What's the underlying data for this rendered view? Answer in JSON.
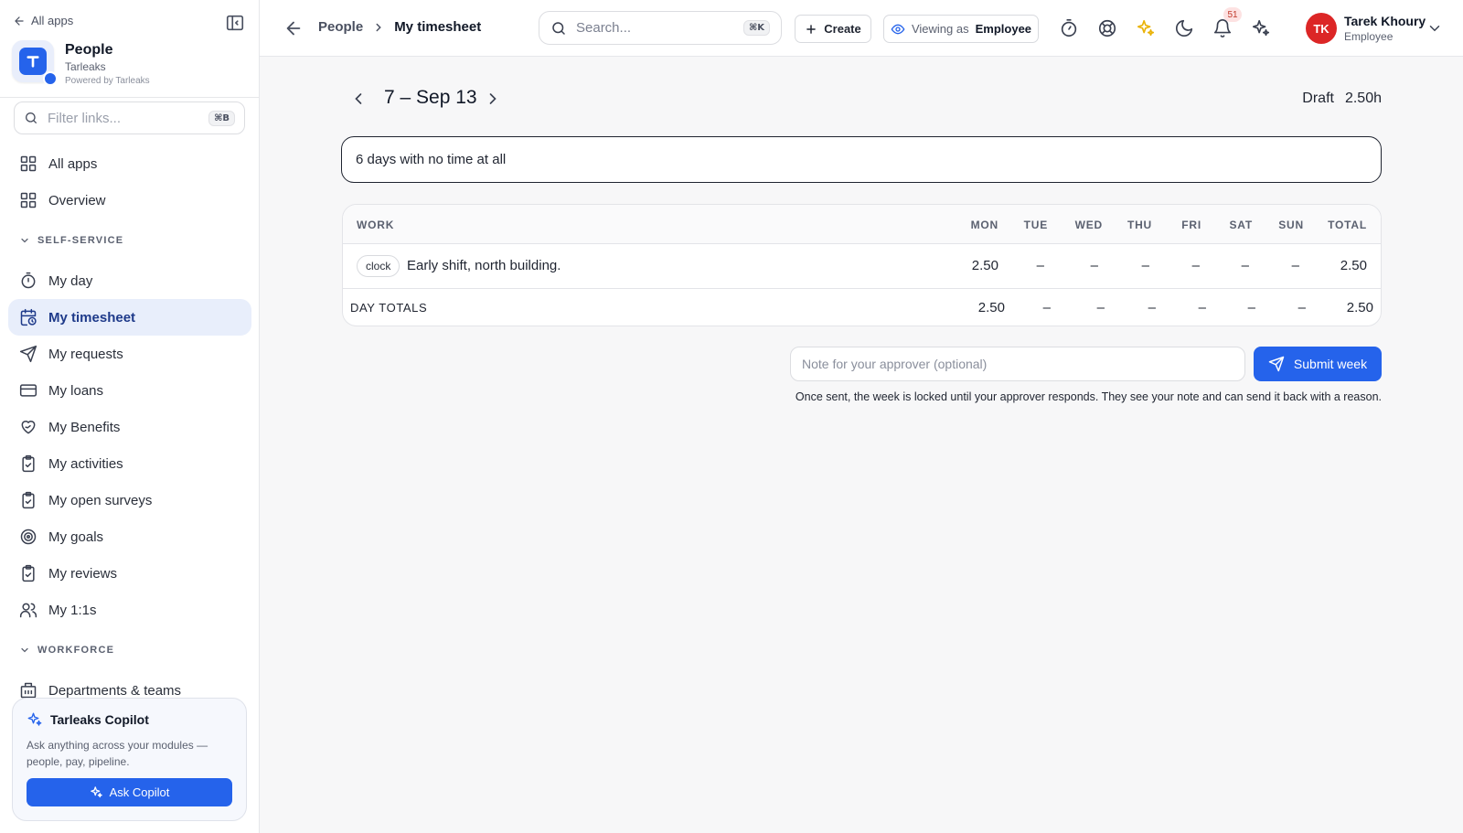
{
  "sidebar": {
    "back_label": "All apps",
    "app": {
      "name": "People",
      "org": "Tarleaks",
      "powered_by": "Powered by Tarleaks"
    },
    "filter": {
      "placeholder": "Filter links...",
      "shortcut": "⌘B"
    },
    "top_items": [
      {
        "label": "All apps",
        "icon": "grid-icon"
      },
      {
        "label": "Overview",
        "icon": "grid-icon"
      }
    ],
    "section_self_service": "SELF-SERVICE",
    "self_service_items": [
      {
        "label": "My day",
        "icon": "timer-icon"
      },
      {
        "label": "My timesheet",
        "icon": "calendar-clock-icon",
        "active": true
      },
      {
        "label": "My requests",
        "icon": "send-icon"
      },
      {
        "label": "My loans",
        "icon": "credit-card-icon"
      },
      {
        "label": "My Benefits",
        "icon": "heart-hand-icon"
      },
      {
        "label": "My activities",
        "icon": "clipboard-check-icon"
      },
      {
        "label": "My open surveys",
        "icon": "clipboard-check-icon"
      },
      {
        "label": "My goals",
        "icon": "target-icon"
      },
      {
        "label": "My reviews",
        "icon": "clipboard-check-icon"
      },
      {
        "label": "My 1:1s",
        "icon": "users-icon"
      }
    ],
    "section_workforce": "WORKFORCE",
    "workforce_items": [
      {
        "label": "Departments & teams",
        "icon": "building-icon"
      }
    ],
    "copilot": {
      "title": "Tarleaks Copilot",
      "description": "Ask anything across your modules — people, pay, pipeline.",
      "button": "Ask Copilot"
    }
  },
  "header": {
    "breadcrumb": {
      "parent": "People",
      "current": "My timesheet"
    },
    "search": {
      "placeholder": "Search...",
      "shortcut": "⌘K"
    },
    "create_label": "Create",
    "viewing_as": {
      "prefix": "Viewing as",
      "role": "Employee"
    },
    "notifications_count": "51",
    "user": {
      "initials": "TK",
      "name": "Tarek Khoury",
      "role": "Employee"
    },
    "colors": {
      "accent": "#2563eb",
      "avatar": "#dc2626",
      "sparkle": "#eab308"
    }
  },
  "timesheet": {
    "week_label": "7 – Sep 13",
    "status": "Draft",
    "total_hours": "2.50h",
    "alert": "6 days with no time at all",
    "columns": [
      "WORK",
      "MON",
      "TUE",
      "WED",
      "THU",
      "FRI",
      "SAT",
      "SUN",
      "TOTAL"
    ],
    "rows": [
      {
        "tag": "clock",
        "work": "Early shift, north building.",
        "days": [
          "2.50",
          "–",
          "–",
          "–",
          "–",
          "–",
          "–"
        ],
        "total": "2.50"
      }
    ],
    "footer": {
      "label": "DAY TOTALS",
      "days": [
        "2.50",
        "–",
        "–",
        "–",
        "–",
        "–",
        "–"
      ],
      "total": "2.50"
    },
    "note_placeholder": "Note for your approver (optional)",
    "submit_label": "Submit week",
    "help_text": "Once sent, the week is locked until your approver responds. They see your note and can send it back with a reason."
  }
}
